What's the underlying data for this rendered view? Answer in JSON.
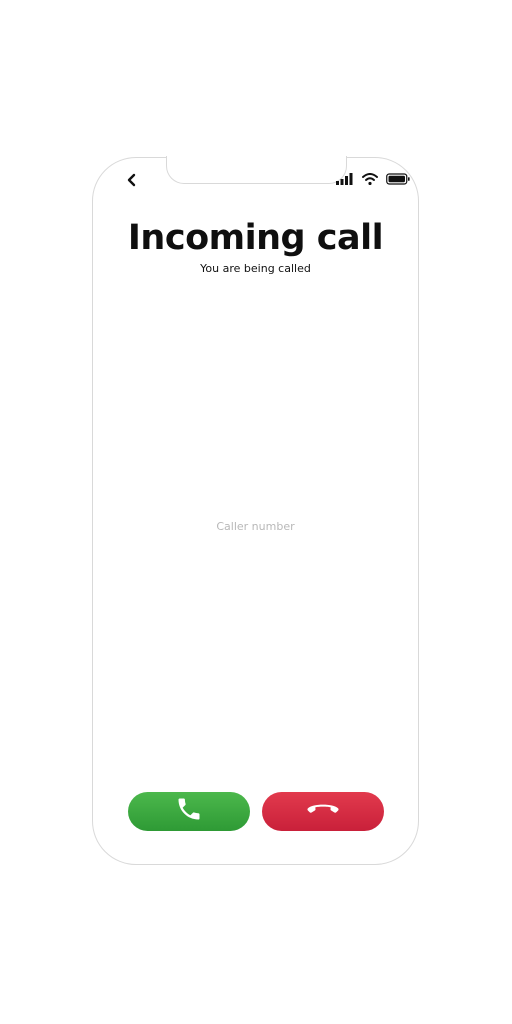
{
  "header": {
    "title": "Incoming call",
    "subtitle": "You are being called"
  },
  "caller": {
    "placeholder": "Caller number"
  },
  "status_bar": {
    "icons": [
      "back-chevron-icon",
      "signal-bars-icon",
      "wifi-icon",
      "battery-icon"
    ]
  },
  "actions": {
    "accept": {
      "icon": "phone-icon",
      "color": "#3aa83f"
    },
    "decline": {
      "icon": "phone-hangup-icon",
      "color": "#d72c42"
    }
  }
}
